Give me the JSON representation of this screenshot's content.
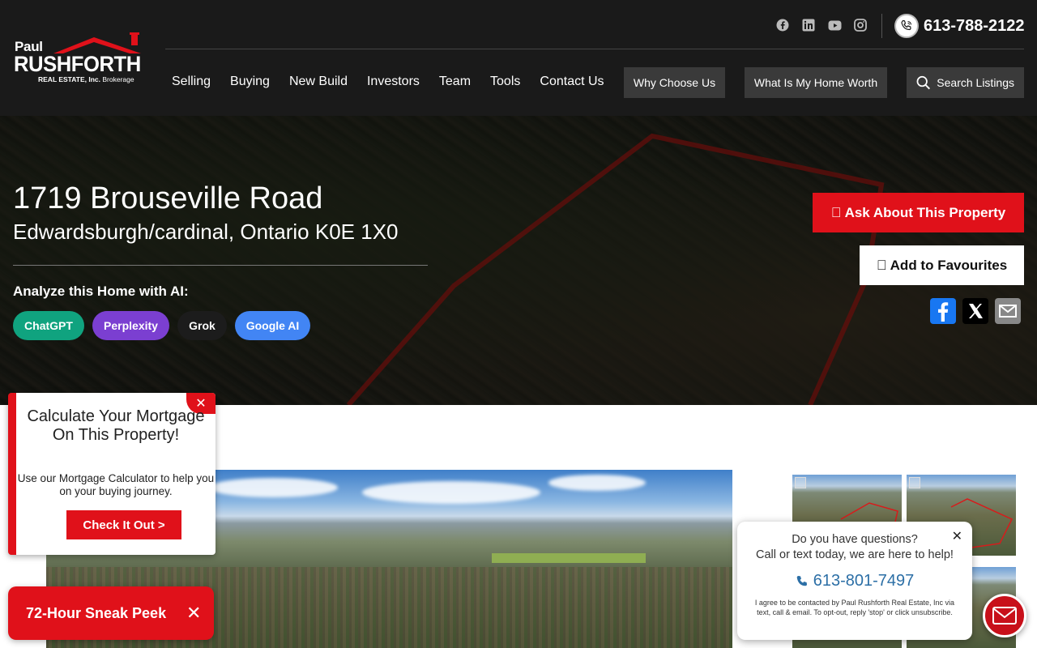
{
  "logo": {
    "first": "Paul",
    "last": "RUSHFORTH",
    "sub_bold": "REAL ESTATE, Inc.",
    "sub_light": "Brokerage"
  },
  "header": {
    "phone": "613-788-2122",
    "social": [
      "facebook-icon",
      "linkedin-icon",
      "youtube-icon",
      "instagram-icon"
    ],
    "nav": [
      "Selling",
      "Buying",
      "New Build",
      "Investors",
      "Team",
      "Tools",
      "Contact Us"
    ],
    "why_choose": "Why Choose Us",
    "home_worth": "What Is My Home Worth",
    "search": "Search Listings"
  },
  "property": {
    "address": "1719 Brouseville Road",
    "city_line": "Edwardsburgh/cardinal, Ontario K0E 1X0",
    "ask_label": "\u0000 Ask About This Property",
    "fav_label": "\u0000 Add to Favourites"
  },
  "ai": {
    "title": "Analyze this Home with AI:",
    "tools": [
      {
        "label": "ChatGPT",
        "color": "#10a37f"
      },
      {
        "label": "Perplexity",
        "color": "#7b3fd1"
      },
      {
        "label": "Grok",
        "color": "#1c1c1c"
      },
      {
        "label": "Google AI",
        "color": "#4285f4"
      }
    ]
  },
  "share": [
    "facebook-share-icon",
    "x-share-icon",
    "email-share-icon"
  ],
  "mortgage_popup": {
    "title": "Calculate Your Mortgage On This Property!",
    "desc": "Use our Mortgage Calculator to help you on your buying journey.",
    "cta": "Check It Out >"
  },
  "sneak_peek": {
    "label": "72-Hour Sneak Peek",
    "close": "✕"
  },
  "questions_popup": {
    "line1": "Do you have questions?",
    "line2": "Call or text today, we are here to help!",
    "phone": "613-801-7497",
    "fine": "I agree to be contacted by Paul Rushforth Real Estate, Inc via text, call & email. To opt-out, reply 'stop' or click unsubscribe.",
    "close": "✕"
  },
  "colors": {
    "brand_red": "#e0111a",
    "header_bg": "#1a1a1a",
    "phone_blue": "#2c6fa6"
  }
}
